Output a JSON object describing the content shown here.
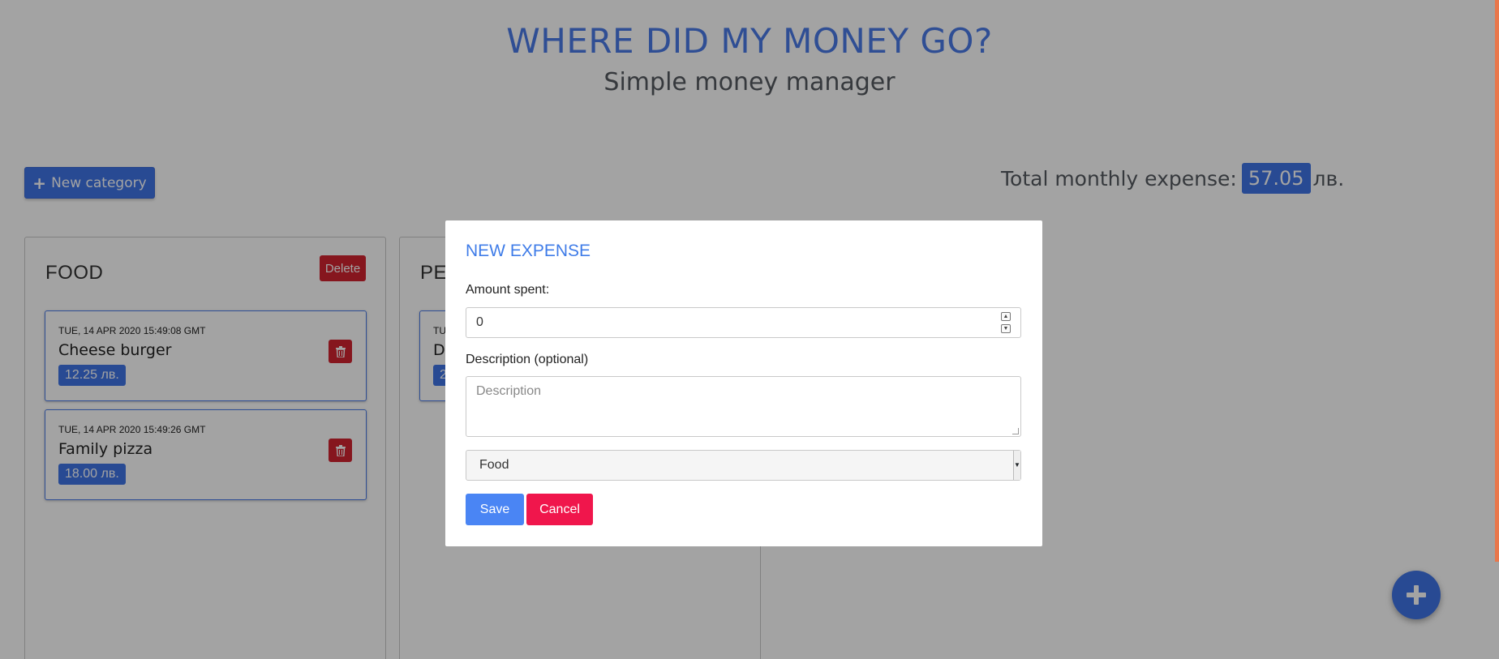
{
  "header": {
    "title": "WHERE DID MY MONEY GO?",
    "subtitle": "Simple money manager"
  },
  "toolbar": {
    "new_category_icon": "plus-icon",
    "new_category_label": "New category"
  },
  "summary": {
    "label": "Total monthly expense:",
    "value": "57.05",
    "currency": "лв."
  },
  "categories": [
    {
      "title": "FOOD",
      "delete_label": "Delete",
      "expenses": [
        {
          "date": "TUE, 14 APR 2020 15:49:08 GMT",
          "name": "Cheese burger",
          "amount": "12.25 лв.",
          "delete_icon": "trash-icon"
        },
        {
          "date": "TUE, 14 APR 2020 15:49:26 GMT",
          "name": "Family pizza",
          "amount": "18.00 лв.",
          "delete_icon": "trash-icon"
        }
      ]
    },
    {
      "title": "PE",
      "expenses": [
        {
          "date": "TU",
          "name": "De",
          "amount": "2"
        }
      ]
    }
  ],
  "fab": {
    "icon": "plus-icon"
  },
  "modal": {
    "title": "NEW EXPENSE",
    "amount_label": "Amount spent:",
    "amount_value": "0",
    "description_label": "Description (optional)",
    "description_placeholder": "Description",
    "category_value": "Food",
    "save_label": "Save",
    "cancel_label": "Cancel"
  },
  "colors": {
    "accent": "#3f74e6",
    "danger": "#d2232f",
    "cancel": "#f0164c",
    "title": "#4a7ae8"
  }
}
